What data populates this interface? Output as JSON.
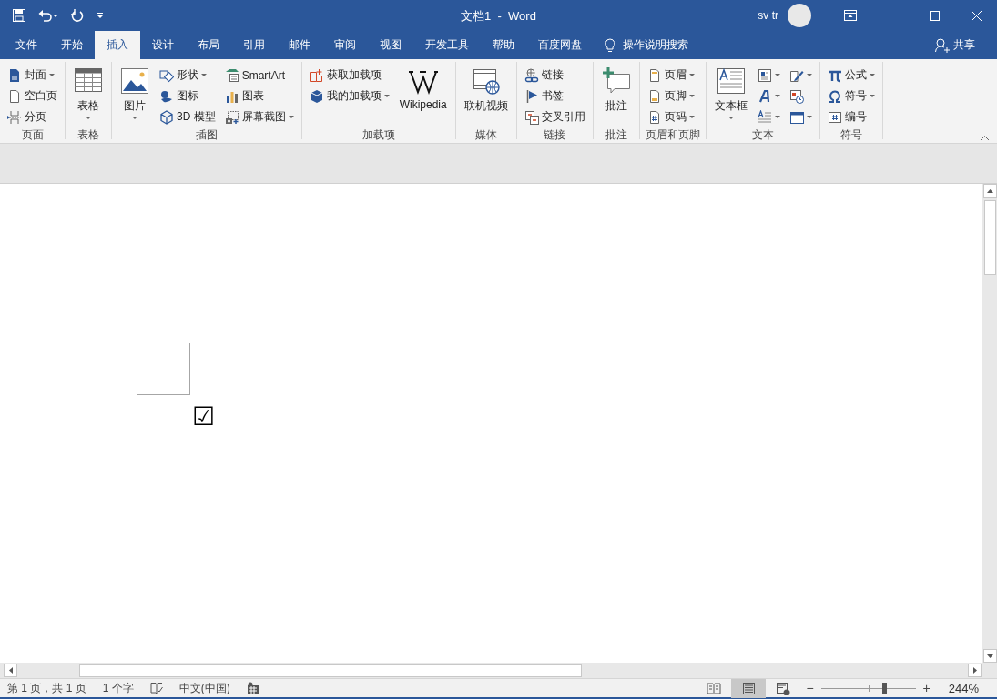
{
  "title_bar": {
    "title": "文档1  -  Word",
    "user": "sv tr"
  },
  "tabs": [
    {
      "label": "文件",
      "selected": false
    },
    {
      "label": "开始",
      "selected": false
    },
    {
      "label": "插入",
      "selected": true
    },
    {
      "label": "设计",
      "selected": false
    },
    {
      "label": "布局",
      "selected": false
    },
    {
      "label": "引用",
      "selected": false
    },
    {
      "label": "邮件",
      "selected": false
    },
    {
      "label": "审阅",
      "selected": false
    },
    {
      "label": "视图",
      "selected": false
    },
    {
      "label": "开发工具",
      "selected": false
    },
    {
      "label": "帮助",
      "selected": false
    },
    {
      "label": "百度网盘",
      "selected": false
    }
  ],
  "tell_me": "操作说明搜索",
  "share": "共享",
  "ribbon": [
    {
      "label": "页面",
      "items": [
        {
          "kind": "small",
          "label": "封面",
          "dropdown": true
        },
        {
          "kind": "small",
          "label": "空白页",
          "dropdown": false
        },
        {
          "kind": "small",
          "label": "分页",
          "dropdown": false
        }
      ]
    },
    {
      "label": "表格",
      "items": [
        {
          "kind": "large",
          "label": "表格",
          "dropdown": true
        }
      ]
    },
    {
      "label": "插图",
      "items": [
        {
          "kind": "large",
          "label": "图片",
          "dropdown": true
        },
        {
          "kind": "small",
          "label": "形状",
          "dropdown": true
        },
        {
          "kind": "small",
          "label": "图标",
          "dropdown": false
        },
        {
          "kind": "small",
          "label": "3D 模型",
          "dropdown": false
        },
        {
          "kind": "small",
          "label": "SmartArt",
          "dropdown": false
        },
        {
          "kind": "small",
          "label": "图表",
          "dropdown": false
        },
        {
          "kind": "small",
          "label": "屏幕截图",
          "dropdown": true
        }
      ]
    },
    {
      "label": "加载项",
      "items": [
        {
          "kind": "small",
          "label": "获取加载项",
          "dropdown": false
        },
        {
          "kind": "small",
          "label": "我的加载项",
          "dropdown": true
        },
        {
          "kind": "large",
          "label": "Wikipedia",
          "dropdown": false
        }
      ]
    },
    {
      "label": "媒体",
      "items": [
        {
          "kind": "large",
          "label": "联机视频",
          "dropdown": false
        }
      ]
    },
    {
      "label": "链接",
      "items": [
        {
          "kind": "small",
          "label": "链接",
          "dropdown": false
        },
        {
          "kind": "small",
          "label": "书签",
          "dropdown": false
        },
        {
          "kind": "small",
          "label": "交叉引用",
          "dropdown": false
        }
      ]
    },
    {
      "label": "批注",
      "items": [
        {
          "kind": "large",
          "label": "批注",
          "dropdown": false
        }
      ]
    },
    {
      "label": "页眉和页脚",
      "items": [
        {
          "kind": "small",
          "label": "页眉",
          "dropdown": true
        },
        {
          "kind": "small",
          "label": "页脚",
          "dropdown": true
        },
        {
          "kind": "small",
          "label": "页码",
          "dropdown": true
        }
      ]
    },
    {
      "label": "文本",
      "items": [
        {
          "kind": "large",
          "label": "文本框",
          "dropdown": true
        },
        {
          "kind": "icon",
          "dropdown": true
        },
        {
          "kind": "icon",
          "dropdown": true
        },
        {
          "kind": "icon",
          "dropdown": true
        },
        {
          "kind": "icon",
          "dropdown": true
        },
        {
          "kind": "icon",
          "dropdown": false
        },
        {
          "kind": "icon",
          "dropdown": true
        }
      ]
    },
    {
      "label": "符号",
      "items": [
        {
          "kind": "small",
          "label": "公式",
          "dropdown": true
        },
        {
          "kind": "small",
          "label": "符号",
          "dropdown": true
        },
        {
          "kind": "small",
          "label": "编号",
          "dropdown": false
        }
      ]
    }
  ],
  "document": {
    "content": "☑"
  },
  "status_bar": {
    "page": "第 1 页，共 1 页",
    "words": "1 个字",
    "language": "中文(中国)",
    "views": [
      {
        "kind": "read",
        "selected": false
      },
      {
        "kind": "print",
        "selected": true
      },
      {
        "kind": "web",
        "selected": false
      }
    ],
    "zoom_out": "−",
    "zoom_in": "+",
    "zoom": {
      "level": 0.68
    },
    "zoom_label": "244%"
  }
}
